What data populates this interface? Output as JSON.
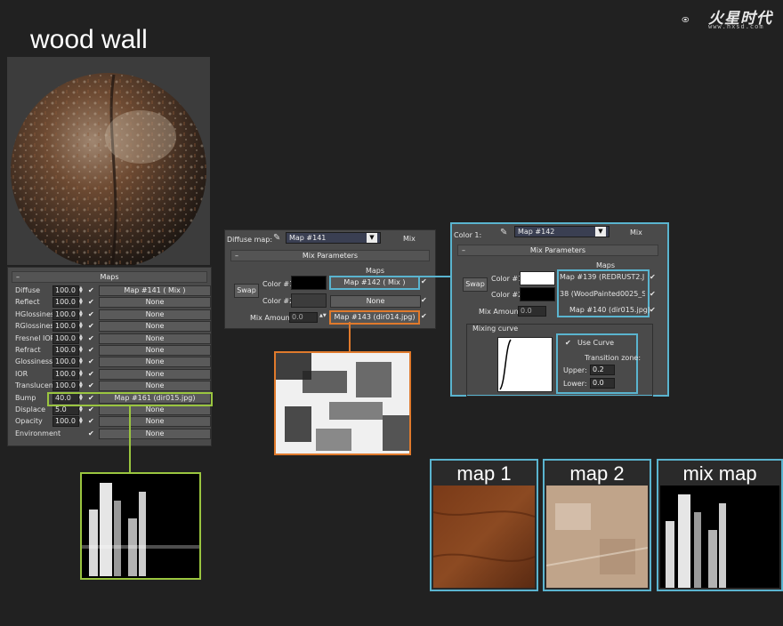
{
  "title": "wood wall",
  "logo": {
    "text": "火星时代",
    "url_text": "www.hxsd.com"
  },
  "material_maps": {
    "header": "Maps",
    "rows": [
      {
        "label": "Diffuse",
        "amount": "100.0",
        "checked": true,
        "map": "Map #141  ( Mix )"
      },
      {
        "label": "Reflect",
        "amount": "100.0",
        "checked": true,
        "map": "None"
      },
      {
        "label": "HGlossiness",
        "amount": "100.0",
        "checked": true,
        "map": "None"
      },
      {
        "label": "RGlossiness",
        "amount": "100.0",
        "checked": true,
        "map": "None"
      },
      {
        "label": "Fresnel IOR",
        "amount": "100.0",
        "checked": true,
        "map": "None"
      },
      {
        "label": "Refract",
        "amount": "100.0",
        "checked": true,
        "map": "None"
      },
      {
        "label": "Glossiness",
        "amount": "100.0",
        "checked": true,
        "map": "None"
      },
      {
        "label": "IOR",
        "amount": "100.0",
        "checked": true,
        "map": "None"
      },
      {
        "label": "Translucent",
        "amount": "100.0",
        "checked": true,
        "map": "None"
      },
      {
        "label": "Bump",
        "amount": "40.0",
        "checked": true,
        "map": "Map #161 (dir015.jpg)"
      },
      {
        "label": "Displace",
        "amount": "5.0",
        "checked": true,
        "map": "None"
      },
      {
        "label": "Opacity",
        "amount": "100.0",
        "checked": true,
        "map": "None"
      },
      {
        "label": "Environment",
        "amount": "",
        "checked": true,
        "map": "None"
      }
    ]
  },
  "mix1": {
    "slot_label": "Diffuse map:",
    "map_name": "Map #141",
    "type": "Mix",
    "rollout": "Mix Parameters",
    "maps_header": "Maps",
    "swap": "Swap",
    "color1_label": "Color #1",
    "color2_label": "Color #2",
    "color1_map": "Map #142  ( Mix )",
    "color2_map": "None",
    "mix_amount_label": "Mix Amount:",
    "mix_amount": "0.0",
    "mix_map": "Map #143 (dir014.jpg)"
  },
  "mix2": {
    "slot_label": "Color 1:",
    "map_name": "Map #142",
    "type": "Mix",
    "rollout": "Mix Parameters",
    "maps_header": "Maps",
    "swap": "Swap",
    "color1_label": "Color #1",
    "color2_label": "Color #2",
    "color1_map": "Map #139 (REDRUST2.JPG)",
    "color2_map": "38 (WoodPainted0025_S.jpg)",
    "mix_amount_label": "Mix Amount:",
    "mix_amount": "0.0",
    "mix_map": "Map #140 (dir015.jpg)",
    "mixing_curve_label": "Mixing curve",
    "use_curve_label": "Use Curve",
    "transition_label": "Transition zone:",
    "upper_label": "Upper:",
    "upper": "0.2",
    "lower_label": "Lower:",
    "lower": "0.0"
  },
  "thumbs": {
    "map1": "map 1",
    "map2": "map 2",
    "mixmap": "mix map"
  },
  "colors": {
    "green_highlight": "#9ac53f",
    "blue_highlight": "#5ab4cf",
    "orange_highlight": "#e07a2c",
    "background": "#212121"
  }
}
